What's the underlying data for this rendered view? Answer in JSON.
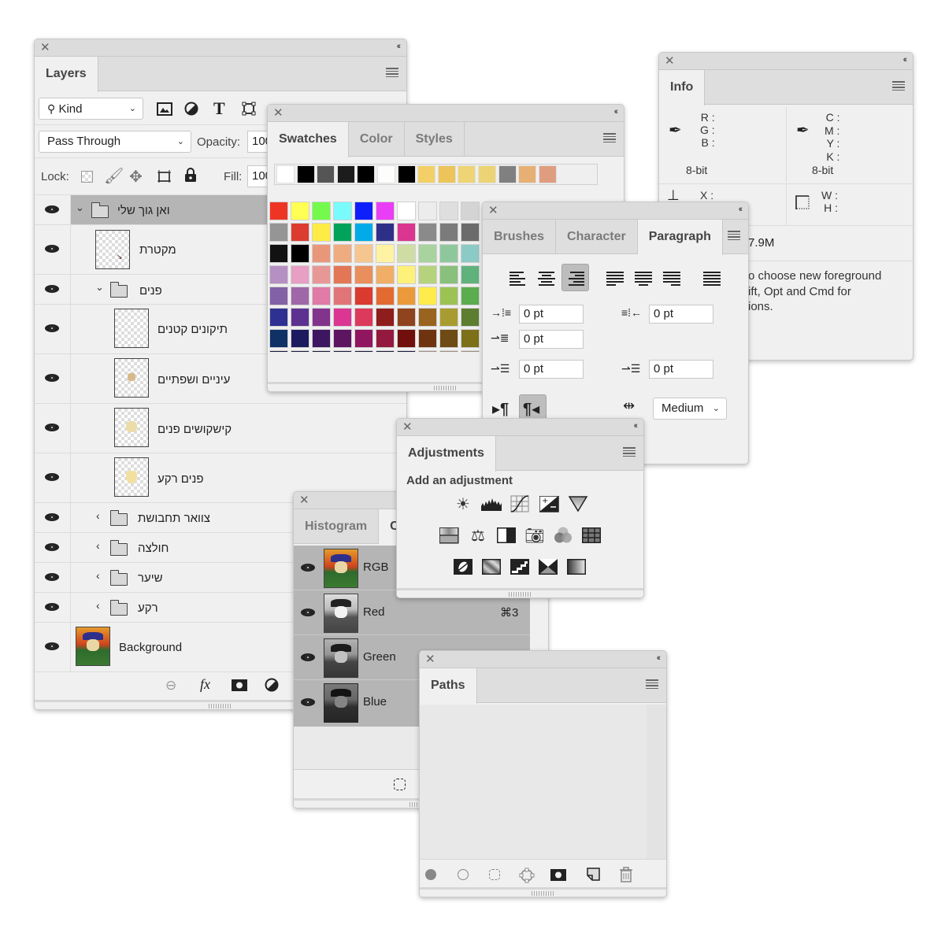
{
  "layers_panel": {
    "tab": "Layers",
    "filter_kind": "Kind",
    "blend_mode": "Pass Through",
    "opacity_label": "Opacity:",
    "opacity_value": "100%",
    "lock_label": "Lock:",
    "fill_label": "Fill:",
    "fill_value": "100%",
    "layers": [
      {
        "name": "ואן גוך שלי",
        "type": "group",
        "expanded": true,
        "indent": 0,
        "selected": true
      },
      {
        "name": "מקטרת",
        "type": "layer",
        "indent": 0
      },
      {
        "name": "פנים",
        "type": "group",
        "expanded": true,
        "indent": 1
      },
      {
        "name": "תיקונים קטנים",
        "type": "layer",
        "indent": 1
      },
      {
        "name": "עיניים ושפתיים",
        "type": "layer",
        "indent": 1
      },
      {
        "name": "קישקושים פנים",
        "type": "layer",
        "indent": 1
      },
      {
        "name": "פנים רקע",
        "type": "layer",
        "indent": 1
      },
      {
        "name": "צוואר תחבושת",
        "type": "group",
        "expanded": false,
        "indent": 1
      },
      {
        "name": "חולצה",
        "type": "group",
        "expanded": false,
        "indent": 1
      },
      {
        "name": "שיער",
        "type": "group",
        "expanded": false,
        "indent": 1
      },
      {
        "name": "רקע",
        "type": "group",
        "expanded": false,
        "indent": 1
      },
      {
        "name": "Background",
        "type": "image",
        "indent": 0
      }
    ]
  },
  "swatches_panel": {
    "tabs": [
      "Swatches",
      "Color",
      "Styles"
    ],
    "active_tab": "Swatches",
    "recent_colors": [
      "#ffffff",
      "#000000",
      "#555555",
      "#1c1c1c",
      "#000000",
      "#fdfdfb",
      "#000000",
      "#f2d067",
      "#ecc45a",
      "#eed474",
      "#ecd474",
      "#808080",
      "#e6b075",
      "#df9d80"
    ],
    "grid": [
      [
        "#ee3524",
        "#ffff54",
        "#74fa4c",
        "#79fbfc",
        "#0f1ffb",
        "#e93ef5",
        "#ffffff",
        "#ececec",
        "#dedede",
        "#d4d4d4"
      ],
      [
        "#959595",
        "#dc3b30",
        "#ffeb46",
        "#00a359",
        "#00abe8",
        "#2e3088",
        "#da3590",
        "#8a8a8a",
        "#7b7b7b",
        "#6b6b6b"
      ],
      [
        "#121212",
        "#000000",
        "#e9977a",
        "#f0ac81",
        "#f6c690",
        "#fff3a3",
        "#cfdda5",
        "#a8d39e",
        "#8fc79c",
        "#8ccac6"
      ],
      [
        "#b590c3",
        "#e89fc4",
        "#e79896",
        "#e27655",
        "#e98e5d",
        "#f0ae67",
        "#fef17a",
        "#b5d37c",
        "#89c07b",
        "#5fb27c"
      ],
      [
        "#8361a6",
        "#9f67a8",
        "#e07aa6",
        "#e17478",
        "#da3a30",
        "#e36b32",
        "#ea9a3a",
        "#fdec4c",
        "#9bc353",
        "#5aac4f"
      ],
      [
        "#2f3192",
        "#5d318f",
        "#82338c",
        "#da3692",
        "#dc3a5b",
        "#8f1d1b",
        "#8f441d",
        "#986420",
        "#a89c30",
        "#5d7e30"
      ],
      [
        "#0f3165",
        "#1c1a5f",
        "#3d1561",
        "#5d1461",
        "#911660",
        "#931a3e",
        "#700f0b",
        "#6e3410",
        "#6e4a14",
        "#7c7019"
      ]
    ]
  },
  "info_panel": {
    "tab": "Info",
    "rgb_labels": [
      "R :",
      "G :",
      "B :"
    ],
    "rgb_bitdepth": "8-bit",
    "cmyk_labels": [
      "C :",
      "M :",
      "Y :",
      "K :"
    ],
    "cmyk_bitdepth": "8-bit",
    "xy_labels": [
      "X :"
    ],
    "wh_labels": [
      "W :",
      "H :"
    ],
    "doc_size": "7.9M",
    "hint_lines": [
      "o choose new foreground",
      "ift, Opt and Cmd for",
      "ions."
    ]
  },
  "paragraph_panel": {
    "tabs": [
      "Brushes",
      "Character",
      "Paragraph"
    ],
    "active_tab": "Paragraph",
    "alignment_selected": "right",
    "indent_left": "0 pt",
    "indent_right": "0 pt",
    "indent_first_line": "0 pt",
    "space_before": "0 pt",
    "space_after": "0 pt",
    "direction_selected": "rtl",
    "kashida": "Medium"
  },
  "adjustments_panel": {
    "tab": "Adjustments",
    "heading": "Add an adjustment"
  },
  "channels_panel": {
    "tabs": [
      "Histogram",
      "C"
    ],
    "active_tab": "Channels",
    "channels": [
      {
        "name": "RGB",
        "shortcut": ""
      },
      {
        "name": "Red",
        "shortcut": "⌘3"
      },
      {
        "name": "Green",
        "shortcut": ""
      },
      {
        "name": "Blue",
        "shortcut": ""
      }
    ]
  },
  "paths_panel": {
    "tab": "Paths"
  }
}
